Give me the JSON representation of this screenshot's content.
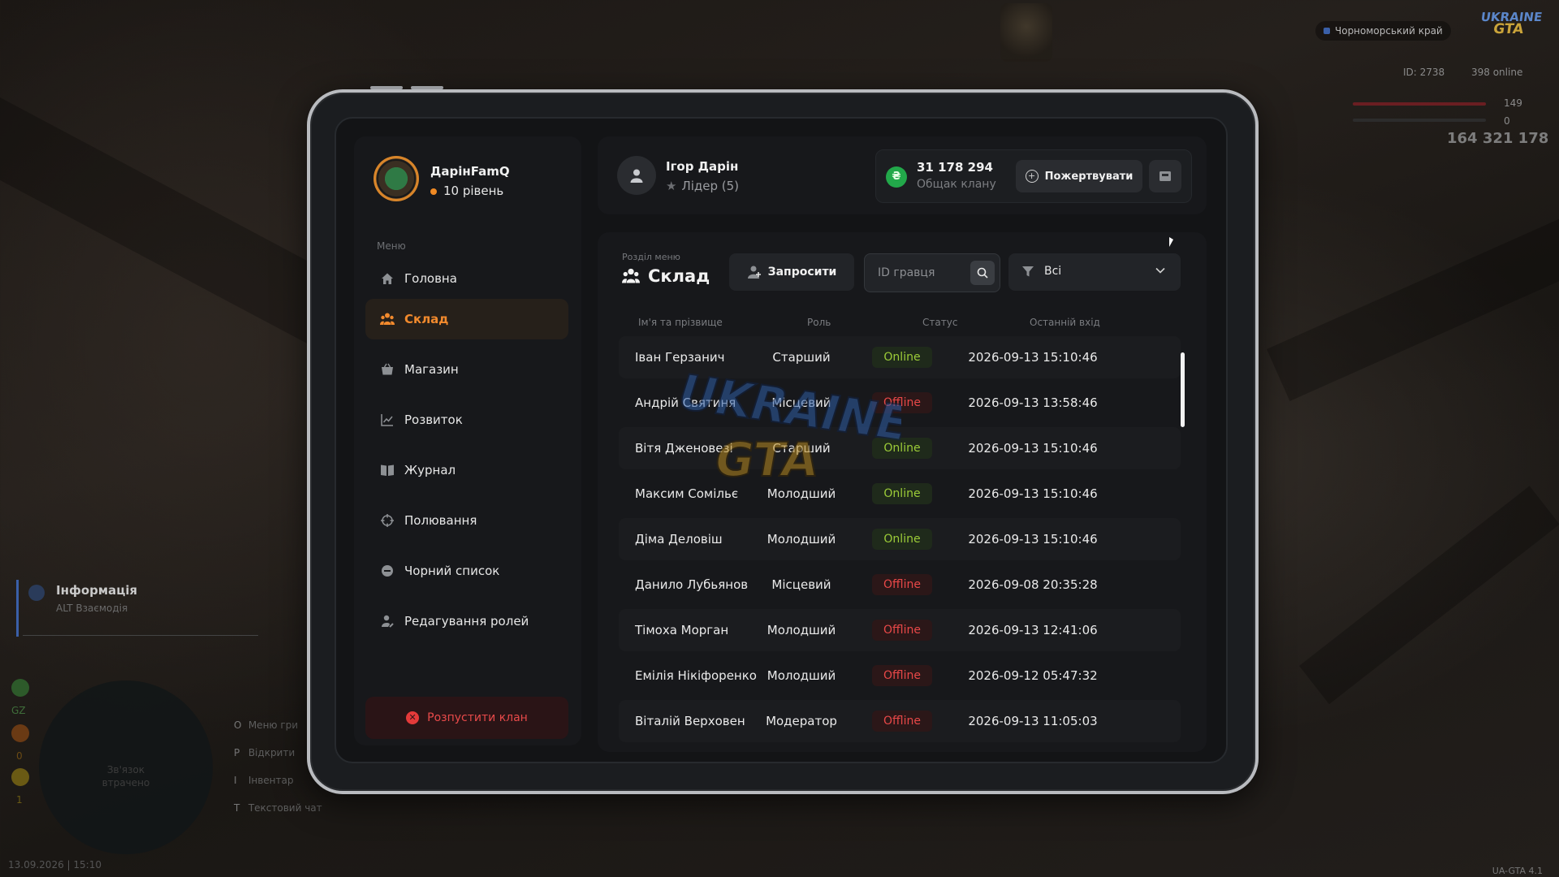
{
  "hud": {
    "region": "Чорноморський край",
    "id_label": "ID: 2738",
    "online": "398 online",
    "health": "149",
    "armor": "0",
    "money": "164 321 178",
    "logo_top": "UKRAINE",
    "logo_bottom": "GTA",
    "info_title": "Інформація",
    "info_sub": "ALT Взаємодія",
    "map_msg_1": "Зв'язок",
    "map_msg_2": "втрачено",
    "hints": [
      {
        "key": "O",
        "label": "Меню гри"
      },
      {
        "key": "P",
        "label": "Відкрити"
      },
      {
        "key": "I",
        "label": "Інвентар"
      },
      {
        "key": "T",
        "label": "Текстовий чат"
      }
    ],
    "stat_gz": "GZ",
    "stat_0": "0",
    "stat_1": "1",
    "date": "13.09.2026 | 15:10",
    "version": "UA-GTA 4.1"
  },
  "sidebar": {
    "username": "ДарінFamQ",
    "level": "10 рівень",
    "menu_label": "Меню",
    "items": [
      {
        "label": "Головна",
        "icon": "home-icon"
      },
      {
        "label": "Склад",
        "icon": "members-icon",
        "active": true
      },
      {
        "label": "Магазин",
        "icon": "shop-icon"
      },
      {
        "label": "Розвиток",
        "icon": "chart-icon"
      },
      {
        "label": "Журнал",
        "icon": "book-icon"
      },
      {
        "label": "Полювання",
        "icon": "crosshair-icon"
      },
      {
        "label": "Чорний список",
        "icon": "block-icon"
      },
      {
        "label": "Редагування ролей",
        "icon": "user-edit-icon"
      }
    ],
    "disband_label": "Розпустити клан"
  },
  "header": {
    "leader_name": "Ігор Дарін",
    "leader_role": "Лідер (5)",
    "balance": "31 178 294",
    "balance_label": "Общак клану",
    "donate_label": "Пожертвувати"
  },
  "panel": {
    "section_caption": "Розділ меню",
    "section_title": "Склад",
    "invite_label": "Запросити",
    "search_placeholder": "ID гравця",
    "filter_value": "Всі",
    "columns": [
      "Ім'я та прізвище",
      "Роль",
      "Статус",
      "Останній вхід"
    ],
    "rows": [
      {
        "name": "Іван Герзанич",
        "role": "Старший",
        "status": "Online",
        "last": "2026-09-13 15:10:46"
      },
      {
        "name": "Андрій Святиня",
        "role": "Місцевий",
        "status": "Offline",
        "last": "2026-09-13 13:58:46"
      },
      {
        "name": "Вітя Дженовезі",
        "role": "Старший",
        "status": "Online",
        "last": "2026-09-13 15:10:46"
      },
      {
        "name": "Максим Сомільє",
        "role": "Молодший",
        "status": "Online",
        "last": "2026-09-13 15:10:46"
      },
      {
        "name": "Діма Деловіш",
        "role": "Молодший",
        "status": "Online",
        "last": "2026-09-13 15:10:46"
      },
      {
        "name": "Данило Лубьянов",
        "role": "Місцевий",
        "status": "Offline",
        "last": "2026-09-08 20:35:28"
      },
      {
        "name": "Тімоха Морган",
        "role": "Молодший",
        "status": "Offline",
        "last": "2026-09-13 12:41:06"
      },
      {
        "name": "Емілія Нікіфоренко",
        "role": "Молодший",
        "status": "Offline",
        "last": "2026-09-12 05:47:32"
      },
      {
        "name": "Віталій Верховен",
        "role": "Модератор",
        "status": "Offline",
        "last": "2026-09-13 11:05:03"
      }
    ]
  },
  "colors": {
    "accent": "#f28a2d",
    "online": "#9ccc38",
    "offline": "#e84848",
    "money": "#22a84a"
  }
}
